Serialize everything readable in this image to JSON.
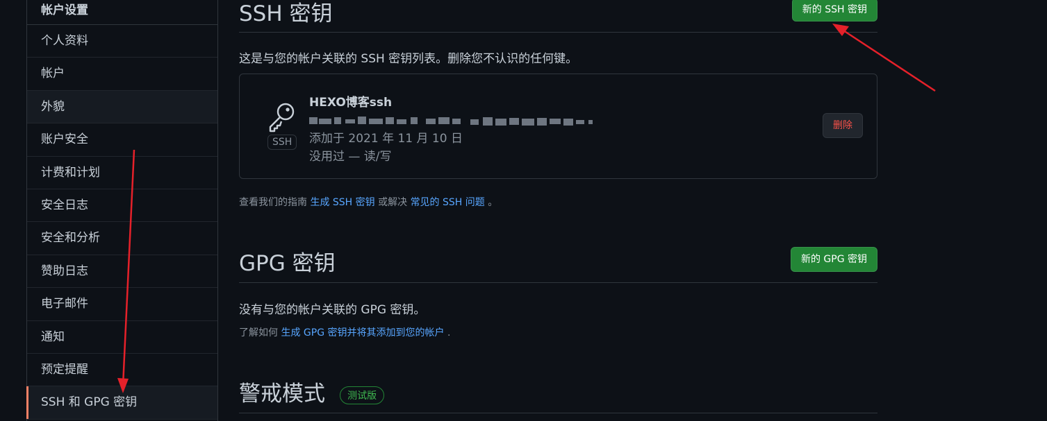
{
  "sidebar": {
    "header": "帐户设置",
    "items": [
      {
        "label": "个人资料"
      },
      {
        "label": "帐户"
      },
      {
        "label": "外貌"
      },
      {
        "label": "账户安全"
      },
      {
        "label": "计费和计划"
      },
      {
        "label": "安全日志"
      },
      {
        "label": "安全和分析"
      },
      {
        "label": "赞助日志"
      },
      {
        "label": "电子邮件"
      },
      {
        "label": "通知"
      },
      {
        "label": "预定提醒"
      },
      {
        "label": "SSH 和 GPG 密钥"
      }
    ]
  },
  "ssh": {
    "title": "SSH 密钥",
    "new_button": "新的 SSH 密钥",
    "description": "这是与您的帐户关联的 SSH 密钥列表。删除您不认识的任何键。",
    "key": {
      "name": "HEXO博客ssh",
      "tag": "SSH",
      "added": "添加于 2021 年 11 月 10 日",
      "usage": "没用过 — 读/写",
      "delete_button": "删除"
    },
    "guide": {
      "prefix": "查看我们的指南",
      "link1": "生成 SSH 密钥",
      "middle": "或解决",
      "link2": "常见的 SSH 问题",
      "suffix": "。"
    }
  },
  "gpg": {
    "title": "GPG 密钥",
    "new_button": "新的 GPG 密钥",
    "description": "没有与您的帐户关联的 GPG 密钥。",
    "learn": {
      "prefix": "了解如何",
      "link": "生成 GPG 密钥并将其添加到您的帐户",
      "suffix": "."
    }
  },
  "vigilant": {
    "title": "警戒模式",
    "badge": "测试版"
  },
  "colors": {
    "background": "#0d1117",
    "accent_green": "#238636",
    "link": "#58a6ff",
    "danger": "#f85149",
    "annotation_arrow": "#e5212a"
  }
}
